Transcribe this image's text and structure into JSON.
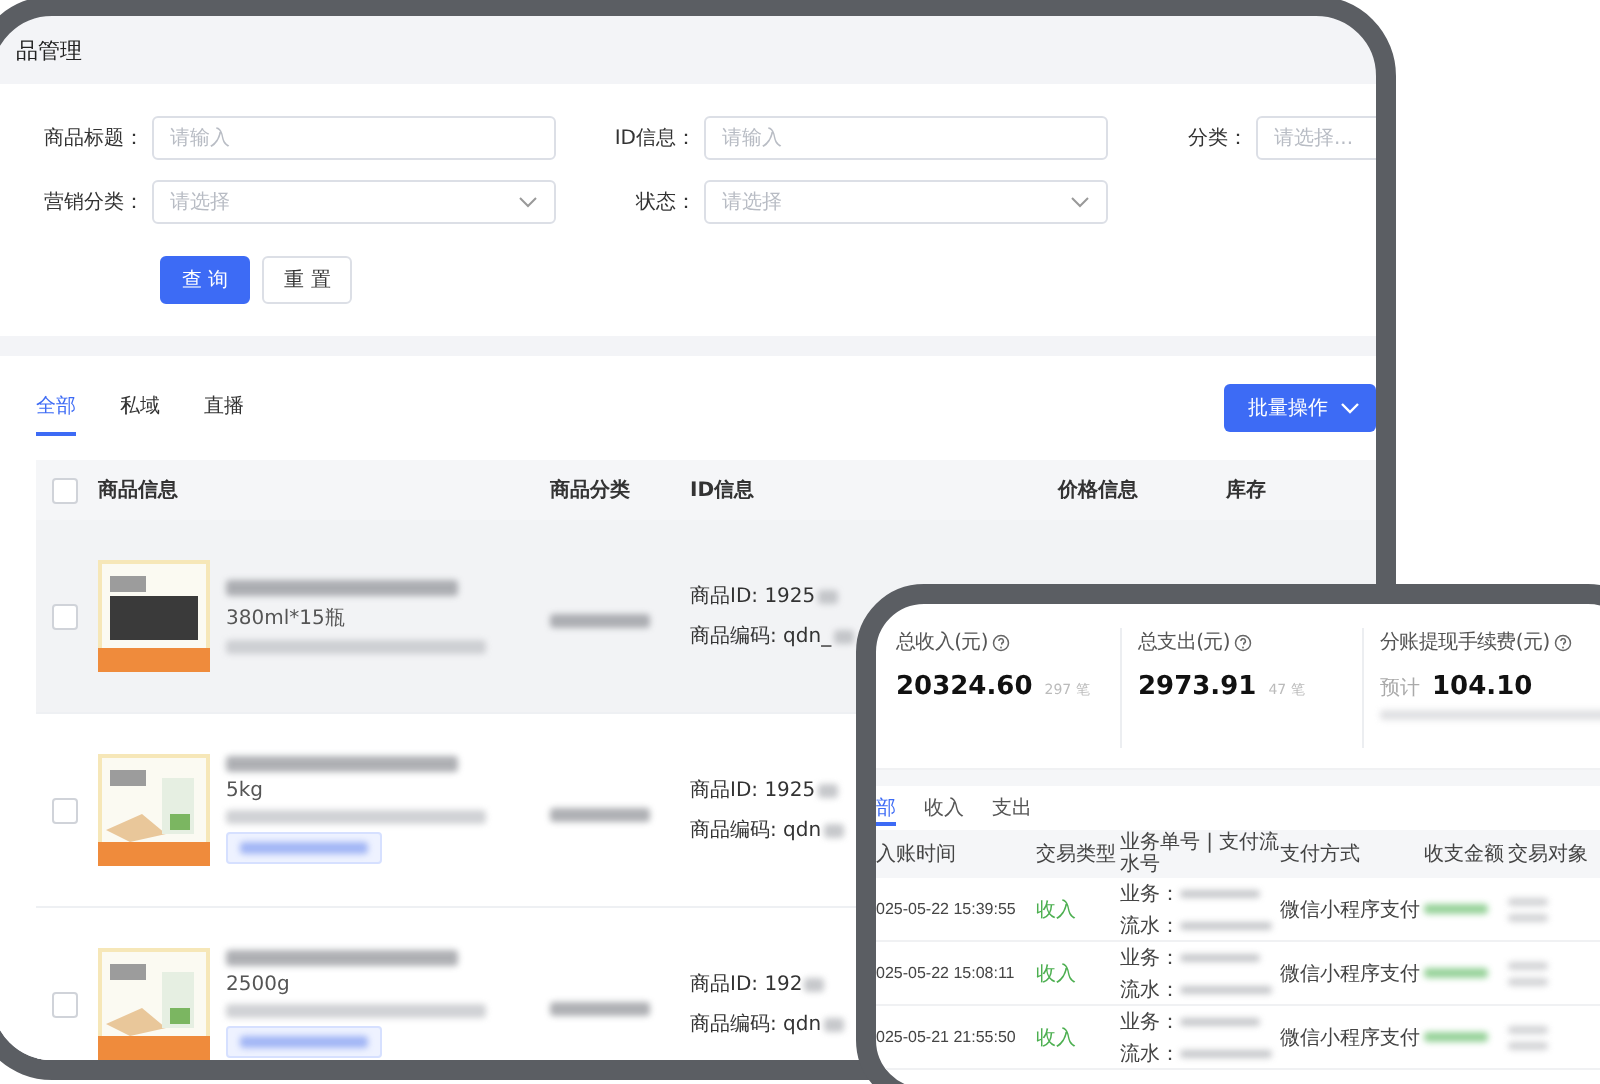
{
  "main_window": {
    "title": "品管理",
    "filters": [
      {
        "label": "商品标题：",
        "placeholder": "请输入",
        "kind": "input"
      },
      {
        "label": "ID信息：",
        "placeholder": "请输入",
        "kind": "input"
      },
      {
        "label": "分类：",
        "placeholder": "请选择...",
        "kind": "input"
      },
      {
        "label": "营销分类：",
        "placeholder": "请选择",
        "kind": "select"
      },
      {
        "label": "状态：",
        "placeholder": "请选择",
        "kind": "select"
      }
    ],
    "buttons": [
      {
        "label": "查 询",
        "kind": "primary"
      },
      {
        "label": "重 置",
        "kind": "default"
      }
    ],
    "tabs": [
      {
        "label": "全部",
        "selected": true
      },
      {
        "label": "私域",
        "selected": false
      },
      {
        "label": "直播",
        "selected": false
      }
    ],
    "batch_button": "批量操作",
    "table": {
      "header_checked": false,
      "columns": [
        "商品信息",
        "商品分类",
        "ID信息",
        "价格信息",
        "库存"
      ],
      "rows": [
        {
          "checked": false,
          "highlighted": true,
          "size": "380ml*15瓶",
          "tag": false,
          "id_prefix": "商品ID: 1925",
          "code_prefix": "商品编码: qdn_"
        },
        {
          "checked": false,
          "highlighted": false,
          "size": "5kg",
          "tag": true,
          "id_prefix": "商品ID: 1925",
          "code_prefix": "商品编码: qdn"
        },
        {
          "checked": false,
          "highlighted": false,
          "size": "2500g",
          "tag": true,
          "id_prefix": "商品ID: 192",
          "code_prefix": "商品编码: qdn"
        }
      ]
    }
  },
  "finance_window": {
    "stats": [
      {
        "label": "总收入(元)",
        "value": "20324.60",
        "count": "297 笔"
      },
      {
        "label": "总支出(元)",
        "value": "2973.91",
        "count": "47 笔"
      },
      {
        "label": "分账提现手续费(元)",
        "prefix": "预计",
        "value": "104.10"
      }
    ],
    "tabs": [
      {
        "label": "部",
        "selected": true
      },
      {
        "label": "收入",
        "selected": false
      },
      {
        "label": "支出",
        "selected": false
      }
    ],
    "table": {
      "columns": [
        "入账时间",
        "交易类型",
        "业务单号 | 支付流水号",
        "支付方式",
        "收支金额",
        "交易对象"
      ],
      "rows": [
        {
          "time": "025-05-22 15:39:55",
          "type": "收入",
          "biz_label": "业务：",
          "flow_label": "流水：",
          "method": "微信小程序支付"
        },
        {
          "time": "025-05-22 15:08:11",
          "type": "收入",
          "biz_label": "业务：",
          "flow_label": "流水：",
          "method": "微信小程序支付"
        },
        {
          "time": "025-05-21 21:55:50",
          "type": "收入",
          "biz_label": "业务：",
          "flow_label": "流水：",
          "method": "微信小程序支付"
        }
      ]
    }
  }
}
